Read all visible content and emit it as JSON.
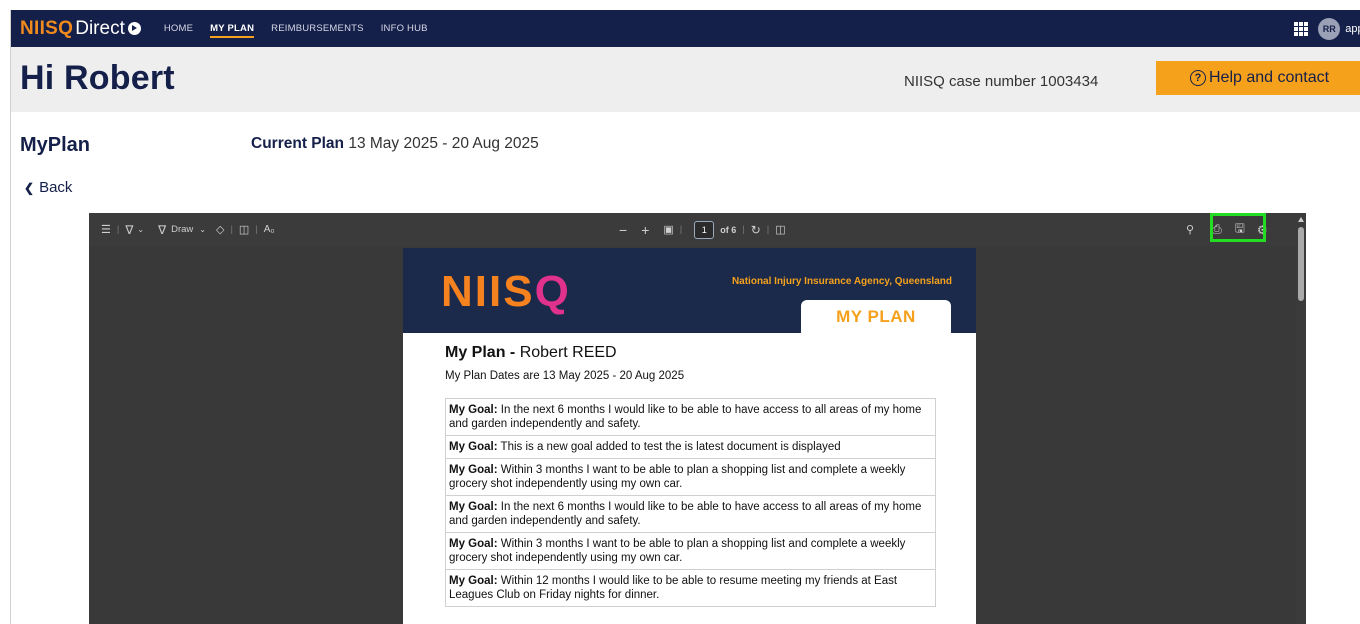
{
  "nav": {
    "brand_part1": "NIISQ",
    "brand_part2": "Direct",
    "links": [
      "HOME",
      "MY PLAN",
      "REIMBURSEMENTS",
      "INFO HUB"
    ],
    "active_link": "MY PLAN",
    "avatar_initials": "RR",
    "app_name": "appi"
  },
  "header": {
    "greeting": "Hi Robert",
    "case_number": "NIISQ case number 1003434",
    "help_label": "Help and contact",
    "help_icon": "?"
  },
  "plan": {
    "title": "MyPlan",
    "current_label": "Current Plan",
    "current_dates": "13 May 2025 - 20 Aug 2025",
    "back_label": "Back"
  },
  "viewer": {
    "draw_label": "Draw",
    "zoom_out": "−",
    "zoom_in": "+",
    "page_current": "1",
    "page_total": "of 6"
  },
  "document": {
    "logo_orange": "NIIS",
    "logo_pink": "Q",
    "agency": "National Injury Insurance Agency, Queensland",
    "tab": "MY PLAN",
    "title_bold": "My Plan - ",
    "title_name": "Robert REED",
    "dates": "My Plan Dates are 13 May 2025 - 20 Aug 2025",
    "goal_label": "My Goal:",
    "goals": [
      " In the next 6 months I would like to be able to have access to all areas of my home and garden independently and safety.",
      " This is a new goal added to test the is latest document is displayed",
      " Within 3 months I want to be able to plan a shopping list and complete a weekly grocery shot independently using my own car.",
      " In the next 6 months I would like to be able to have access to all areas of my home and garden independently and safety.",
      " Within 3 months I want to be able to plan a shopping list and complete a weekly grocery shot independently using my own car.",
      " Within 12 months I would like to be able to resume meeting my friends at East Leagues Club on Friday nights for dinner."
    ]
  },
  "colors": {
    "nav_bg": "#15204a",
    "accent": "#f5a11c",
    "highlight": "#22dd22",
    "viewer_bg": "#393939"
  },
  "icons": {
    "toolbar_left": [
      "list-icon",
      "highlight-icon",
      "draw-icon",
      "eraser-icon",
      "text-box-icon",
      "read-aloud-icon"
    ],
    "toolbar_center": [
      "fit-page-icon",
      "rotate-icon",
      "page-view-icon"
    ],
    "toolbar_right": [
      "search-icon",
      "print-icon",
      "save-icon",
      "settings-icon"
    ]
  }
}
